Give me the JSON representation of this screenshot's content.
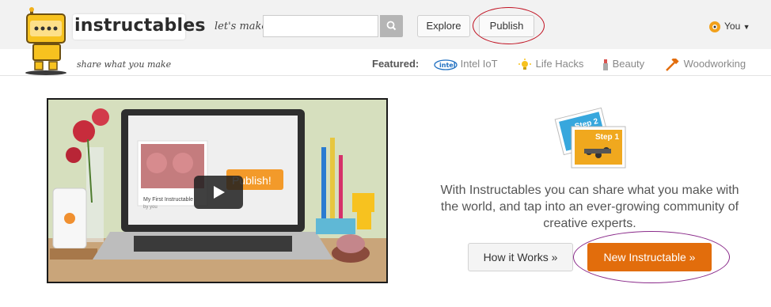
{
  "header": {
    "logo_text": "instructables",
    "lets_make": "let's make",
    "search_placeholder": "",
    "explore_label": "Explore",
    "publish_label": "Publish",
    "user_label": "You"
  },
  "subbar": {
    "tagline": "share what you make",
    "featured_label": "Featured:",
    "featured_items": [
      {
        "label": "Intel IoT",
        "icon": "intel-logo-icon"
      },
      {
        "label": "Life Hacks",
        "icon": "lightbulb-icon"
      },
      {
        "label": "Beauty",
        "icon": "lipstick-icon"
      },
      {
        "label": "Woodworking",
        "icon": "hammer-icon"
      }
    ]
  },
  "video": {
    "publish_overlay": "Publish!",
    "card_title": "My First Instructable",
    "card_sub": "by you"
  },
  "hero": {
    "step_badge_1": "Step 1",
    "step_badge_2": "Step 2",
    "description": "With Instructables you can share what you make with the world, and tap into an ever-growing community of creative experts.",
    "how_label": "How it Works »",
    "new_label": "New Instructable »"
  },
  "colors": {
    "accent_orange": "#e26d0c",
    "annotation_red": "#c01020",
    "annotation_purple": "#8a2a8a"
  }
}
